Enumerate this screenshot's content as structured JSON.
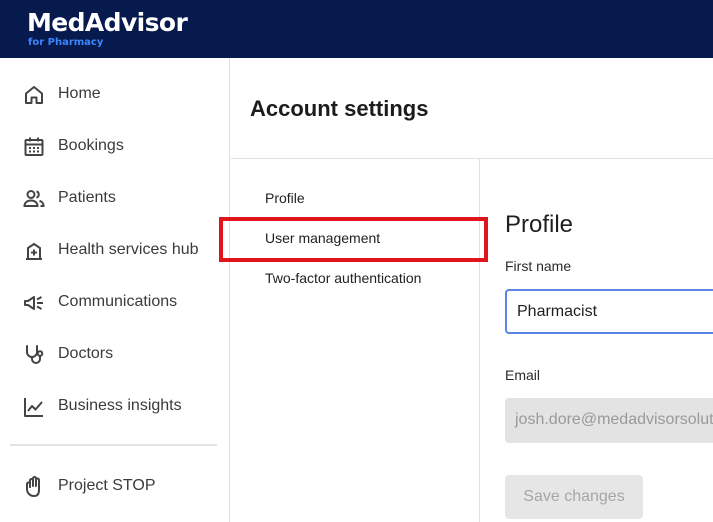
{
  "brand": {
    "name": "MedAdvisor",
    "tagline": "for Pharmacy"
  },
  "sidebar": {
    "items": [
      {
        "label": "Home",
        "icon": "home-icon"
      },
      {
        "label": "Bookings",
        "icon": "calendar-icon"
      },
      {
        "label": "Patients",
        "icon": "people-icon"
      },
      {
        "label": "Health services hub",
        "icon": "health-services-icon"
      },
      {
        "label": "Communications",
        "icon": "megaphone-icon"
      },
      {
        "label": "Doctors",
        "icon": "stethoscope-icon"
      },
      {
        "label": "Business insights",
        "icon": "insights-chart-icon"
      }
    ],
    "footer_item": {
      "label": "Project STOP",
      "icon": "hand-stop-icon"
    }
  },
  "page": {
    "title": "Account settings"
  },
  "settings_nav": {
    "items": [
      "Profile",
      "User management",
      "Two-factor authentication"
    ],
    "highlighted": "User management",
    "highlight_color": "#e0151c"
  },
  "profile": {
    "heading": "Profile",
    "first_name_label": "First name",
    "first_name_value": "Pharmacist",
    "email_label": "Email",
    "email_value": "josh.dore@medadvisorsolutions.com",
    "save_label": "Save changes"
  },
  "colors": {
    "topbar": "#061a4d",
    "brand_accent": "#3d86ff",
    "input_focus": "#5b86e5"
  }
}
